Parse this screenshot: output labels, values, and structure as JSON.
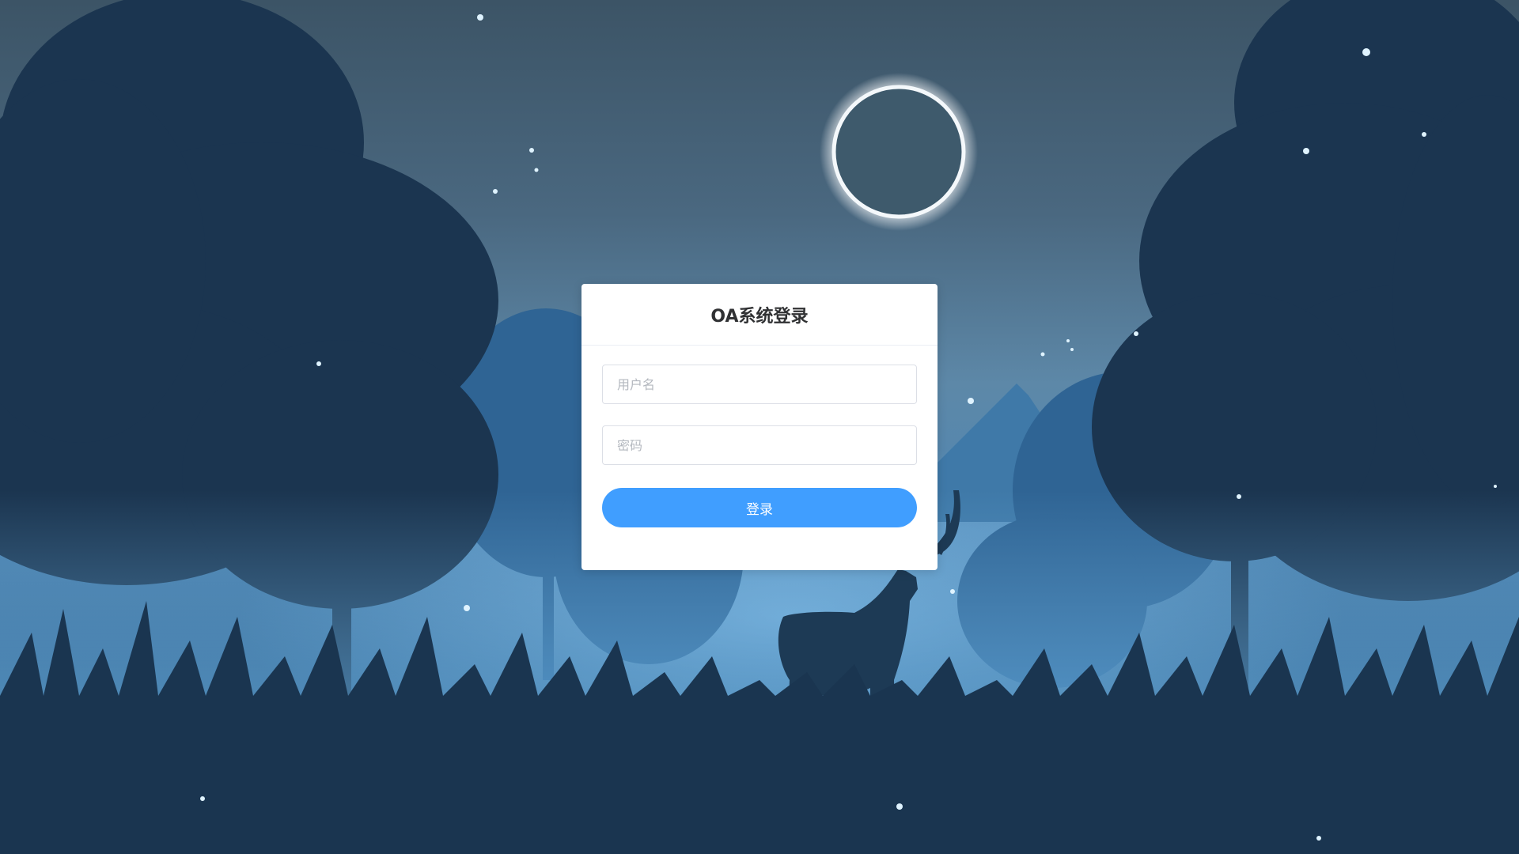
{
  "login": {
    "title": "OA系统登录",
    "username_placeholder": "用户名",
    "password_placeholder": "密码",
    "submit_label": "登录"
  },
  "colors": {
    "primary": "#409eff",
    "card_background": "#ffffff",
    "title_text": "#303133"
  },
  "background": {
    "description_icon": "night-forest-deer-scene"
  }
}
